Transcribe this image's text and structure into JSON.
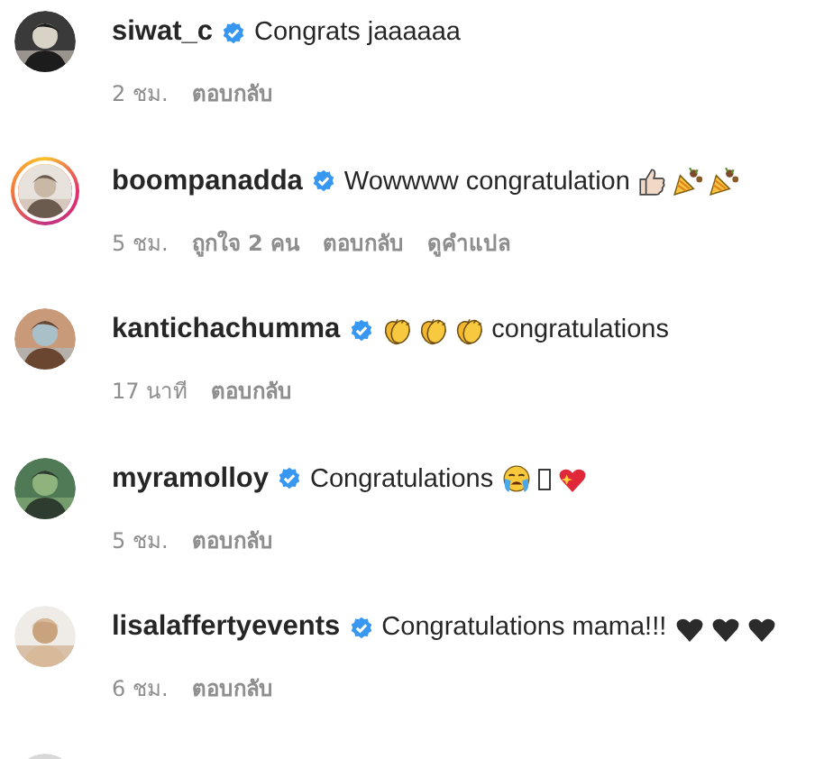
{
  "comments": [
    {
      "username": "siwat_c",
      "verified": true,
      "story": false,
      "text": "Congrats jaaaaaa",
      "meta": [
        {
          "kind": "time",
          "text": "2 ชม."
        },
        {
          "kind": "reply",
          "text": "ตอบกลับ"
        }
      ]
    },
    {
      "username": "boompanadda",
      "verified": true,
      "story": true,
      "text": "Wowwww congratulation",
      "emojis": [
        {
          "kind": "thumbs-up"
        },
        {
          "kind": "party-popper"
        },
        {
          "kind": "party-popper"
        }
      ],
      "meta": [
        {
          "kind": "time",
          "text": "5 ชม."
        },
        {
          "kind": "likes",
          "text": "ถูกใจ **2 คน**"
        },
        {
          "kind": "reply",
          "text": "ตอบกลับ"
        },
        {
          "kind": "translate",
          "text": "ดูคำแปล"
        }
      ]
    },
    {
      "username": "kantichachumma",
      "verified": true,
      "story": false,
      "emojis_first": true,
      "text": "congratulations",
      "emojis": [
        {
          "kind": "clap"
        },
        {
          "kind": "clap"
        },
        {
          "kind": "clap"
        }
      ],
      "meta": [
        {
          "kind": "time",
          "text": "17 นาที"
        },
        {
          "kind": "reply",
          "text": "ตอบกลับ"
        }
      ]
    },
    {
      "username": "myramolloy",
      "verified": true,
      "story": false,
      "text": "Congratulations",
      "emojis": [
        {
          "kind": "crying-face"
        },
        {
          "kind": "missing-glyph"
        },
        {
          "kind": "sparkle-heart"
        }
      ],
      "meta": [
        {
          "kind": "time",
          "text": "5 ชม."
        },
        {
          "kind": "reply",
          "text": "ตอบกลับ"
        }
      ]
    },
    {
      "username": "lisalaffertyevents",
      "verified": true,
      "story": false,
      "text": "Congratulations mama!!!",
      "emojis": [
        {
          "kind": "black-heart"
        },
        {
          "kind": "black-heart"
        },
        {
          "kind": "black-heart"
        }
      ],
      "meta": [
        {
          "kind": "time",
          "text": "6 ชม."
        },
        {
          "kind": "reply",
          "text": "ตอบกลับ"
        }
      ]
    }
  ]
}
